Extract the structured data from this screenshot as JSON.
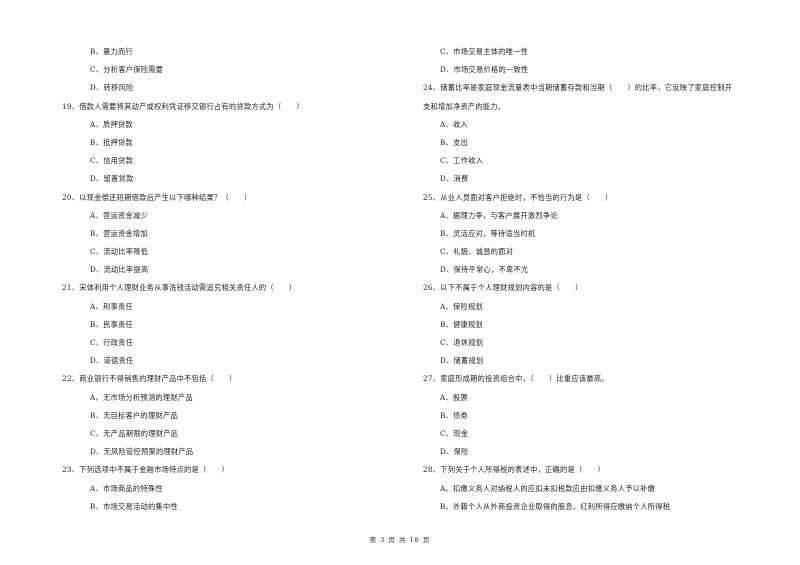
{
  "left_column": [
    {
      "type": "opt",
      "text": "B、量力而行"
    },
    {
      "type": "opt",
      "text": "C、分析客户保险需要"
    },
    {
      "type": "opt",
      "text": "D、转移风险"
    },
    {
      "type": "q",
      "text": "19、借款人需要将其动产或权利凭证移交银行占有的贷款方式为（　　）"
    },
    {
      "type": "opt",
      "text": "A、质押贷款"
    },
    {
      "type": "opt",
      "text": "B、抵押贷款"
    },
    {
      "type": "opt",
      "text": "C、信用贷款"
    },
    {
      "type": "opt",
      "text": "D、留置贷款"
    },
    {
      "type": "q",
      "text": "20、以现金偿还短期借款后产生以下哪种结果？（　　）"
    },
    {
      "type": "opt",
      "text": "A、营运资金减少"
    },
    {
      "type": "opt",
      "text": "B、营运资金增加"
    },
    {
      "type": "opt",
      "text": "C、流动比率降低"
    },
    {
      "type": "opt",
      "text": "D、流动比率提高"
    },
    {
      "type": "q",
      "text": "21、宋体利用个人理财业务从事洗钱活动需追究相关责任人的（　　）"
    },
    {
      "type": "opt",
      "text": "A、刑事责任"
    },
    {
      "type": "opt",
      "text": "B、民事责任"
    },
    {
      "type": "opt",
      "text": "C、行政责任"
    },
    {
      "type": "opt",
      "text": "D、道德责任"
    },
    {
      "type": "q",
      "text": "22、商业银行不得销售的理财产品中不包括（　　）"
    },
    {
      "type": "opt",
      "text": "A、无市场分析预测的理财产品"
    },
    {
      "type": "opt",
      "text": "B、无目标客户的理财产品"
    },
    {
      "type": "opt",
      "text": "C、无产品期限的理财产品"
    },
    {
      "type": "opt",
      "text": "D、无风险管控预案的理财产品"
    },
    {
      "type": "q",
      "text": "23、下列选项中不属于金融市场特点的是（　　）"
    },
    {
      "type": "opt",
      "text": "A、市场商品的特殊性"
    },
    {
      "type": "opt",
      "text": "B、市场交易活动的集中性"
    }
  ],
  "right_column": [
    {
      "type": "opt",
      "text": "C、市场交易主体的唯一性"
    },
    {
      "type": "opt",
      "text": "D、市场交易价格的一致性"
    },
    {
      "type": "q",
      "text": "24、储蓄比率是家庭现金流量表中当期储蓄存款和当期（　　）的比率，它反映了家庭控制开"
    },
    {
      "type": "cont",
      "text": "支和增加净资产的能力。"
    },
    {
      "type": "opt",
      "text": "A、收入"
    },
    {
      "type": "opt",
      "text": "B、支出"
    },
    {
      "type": "opt",
      "text": "C、工作收入"
    },
    {
      "type": "opt",
      "text": "D、消费"
    },
    {
      "type": "q",
      "text": "25、从业人员面对客户拒绝时，不恰当的行为是（　　）"
    },
    {
      "type": "opt",
      "text": "A、据理力争，与客户展开激烈争论"
    },
    {
      "type": "opt",
      "text": "B、灵活应对，等待适当时机"
    },
    {
      "type": "opt",
      "text": "C、礼貌、诚恳的面对"
    },
    {
      "type": "opt",
      "text": "D、保持平常心，不卑不亢"
    },
    {
      "type": "q",
      "text": "26、以下不属于个人理财规划内容的是（　　）"
    },
    {
      "type": "opt",
      "text": "A、保险规划"
    },
    {
      "type": "opt",
      "text": "B、健康规划"
    },
    {
      "type": "opt",
      "text": "C、退休规划"
    },
    {
      "type": "opt",
      "text": "D、储蓄规划"
    },
    {
      "type": "q",
      "text": "27、家庭形成期的投资组合中，（　　）比重应该最高。"
    },
    {
      "type": "opt",
      "text": "A、股票"
    },
    {
      "type": "opt",
      "text": "B、债券"
    },
    {
      "type": "opt",
      "text": "C、现金"
    },
    {
      "type": "opt",
      "text": "D、保险"
    },
    {
      "type": "q",
      "text": "28、下列关于个人所得税的表述中，正确的是（　　）"
    },
    {
      "type": "opt",
      "text": "A、扣缴义务人对纳税人的应扣未扣税款应由扣缴义务人予以补缴"
    },
    {
      "type": "opt",
      "text": "B、外籍个人从外商投资企业取得的股息、红利所得应缴纳个人所得税"
    }
  ],
  "footer": {
    "page_label": "第 3 页 共 18 页"
  }
}
